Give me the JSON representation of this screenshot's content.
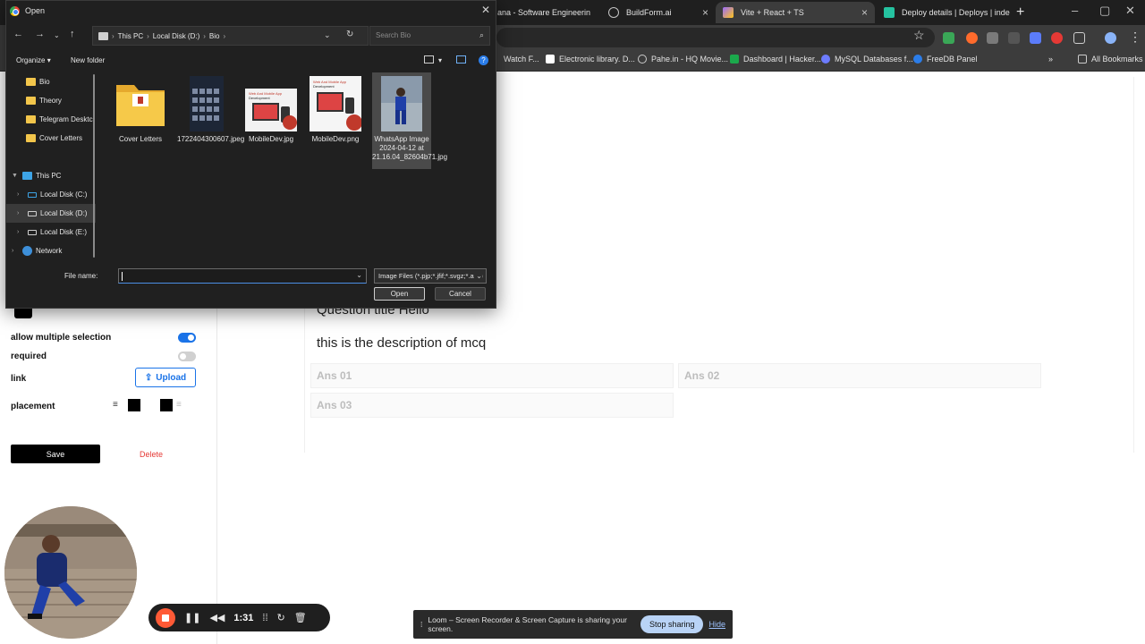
{
  "browser": {
    "tabs": [
      {
        "label": "ana - Software Engineerin",
        "icon": "web-icon",
        "active": false
      },
      {
        "label": "BuildForm.ai",
        "icon": "globe-icon",
        "active": false
      },
      {
        "label": "Vite + React + TS",
        "icon": "vite-icon",
        "active": true
      },
      {
        "label": "Deploy details | Deploys | inde",
        "icon": "netlify-icon",
        "active": false
      }
    ],
    "bookmarks": [
      {
        "label": "Watch F..."
      },
      {
        "label": "Electronic library. D..."
      },
      {
        "label": "Pahe.in - HQ Movie..."
      },
      {
        "label": "Dashboard | Hacker..."
      },
      {
        "label": "MySQL Databases f..."
      },
      {
        "label": "FreeDB Panel"
      }
    ],
    "all_bookmarks": "All Bookmarks"
  },
  "dialog": {
    "title": "Open",
    "path": [
      "This PC",
      "Local Disk (D:)",
      "Bio"
    ],
    "search_placeholder": "Search Bio",
    "organize": "Organize",
    "new_folder": "New folder",
    "nav": [
      {
        "label": "Bio",
        "type": "folder"
      },
      {
        "label": "Theory",
        "type": "folder"
      },
      {
        "label": "Telegram Desktc",
        "type": "folder"
      },
      {
        "label": "Cover Letters",
        "type": "folder"
      },
      {
        "label": "This PC",
        "type": "pc"
      },
      {
        "label": "Local Disk (C:)",
        "type": "drive"
      },
      {
        "label": "Local Disk (D:)",
        "type": "drive"
      },
      {
        "label": "Local Disk (E:)",
        "type": "drive"
      },
      {
        "label": "Network",
        "type": "network"
      }
    ],
    "files": [
      {
        "name": "Cover Letters",
        "kind": "folder"
      },
      {
        "name": "1722404300607.jpeg",
        "kind": "image"
      },
      {
        "name": "MobileDev.jpg",
        "kind": "image"
      },
      {
        "name": "MobileDev.png",
        "kind": "image"
      },
      {
        "name": "WhatsApp Image 2024-04-12 at 21.16.04_82604b71.jpg",
        "kind": "image"
      }
    ],
    "thumb_caption_a": "Web And Mobile App",
    "thumb_caption_b": "Development",
    "file_name_label": "File name:",
    "file_name_value": "",
    "file_type": "Image Files (*.pjp;*.jfif;*.svgz;*.avif)",
    "open_label": "Open",
    "cancel_label": "Cancel"
  },
  "settings": {
    "allow_multiple_label": "allow multiple selection",
    "allow_multiple": true,
    "required_label": "required",
    "required": false,
    "link_label": "link",
    "upload_label": "Upload",
    "placement_label": "placement",
    "save_label": "Save",
    "delete_label": "Delete"
  },
  "question": {
    "title": "Question title Hello",
    "description": "this is the description of mcq",
    "answers": [
      "Ans 01",
      "Ans 02",
      "Ans 03"
    ]
  },
  "loom": {
    "time": "1:31",
    "share_message": "Loom – Screen Recorder & Screen Capture is sharing your screen.",
    "stop_sharing": "Stop sharing",
    "hide": "Hide"
  },
  "colors": {
    "accent": "#1a73e8",
    "delete": "#e53935",
    "loom_record": "#ff5a36",
    "dialog_bg": "#202020"
  }
}
